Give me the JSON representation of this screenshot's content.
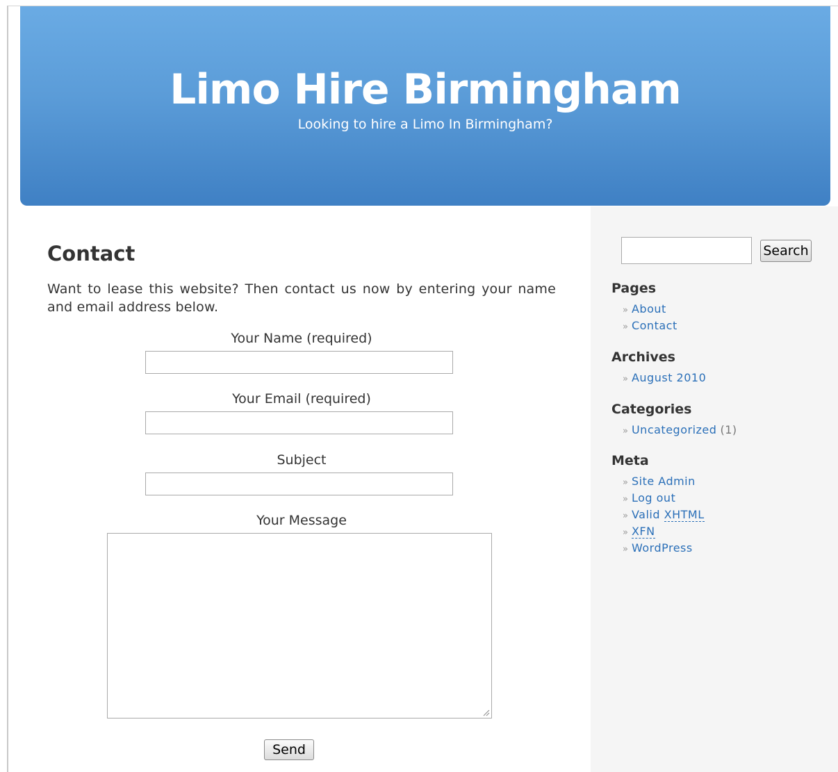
{
  "header": {
    "title": "Limo Hire Birmingham",
    "description": "Looking to hire a Limo In Birmingham?"
  },
  "content": {
    "title": "Contact",
    "intro": "Want to lease this website? Then contact us now by entering your name and email address below.",
    "form": {
      "name_label": "Your Name (required)",
      "email_label": "Your Email (required)",
      "subject_label": "Subject",
      "message_label": "Your Message",
      "name_value": "",
      "email_value": "",
      "subject_value": "",
      "message_value": "",
      "send_label": "Send"
    }
  },
  "sidebar": {
    "search": {
      "value": "",
      "button_label": "Search"
    },
    "pages": {
      "title": "Pages",
      "items": [
        "About",
        "Contact"
      ]
    },
    "archives": {
      "title": "Archives",
      "items": [
        "August 2010"
      ]
    },
    "categories": {
      "title": "Categories",
      "items": [
        {
          "label": "Uncategorized",
          "count": "(1)"
        }
      ]
    },
    "meta": {
      "title": "Meta",
      "site_admin": "Site Admin",
      "log_out": "Log out",
      "valid_prefix": "Valid",
      "xhtml": "XHTML",
      "xfn": "XFN",
      "wordpress": "WordPress"
    }
  }
}
